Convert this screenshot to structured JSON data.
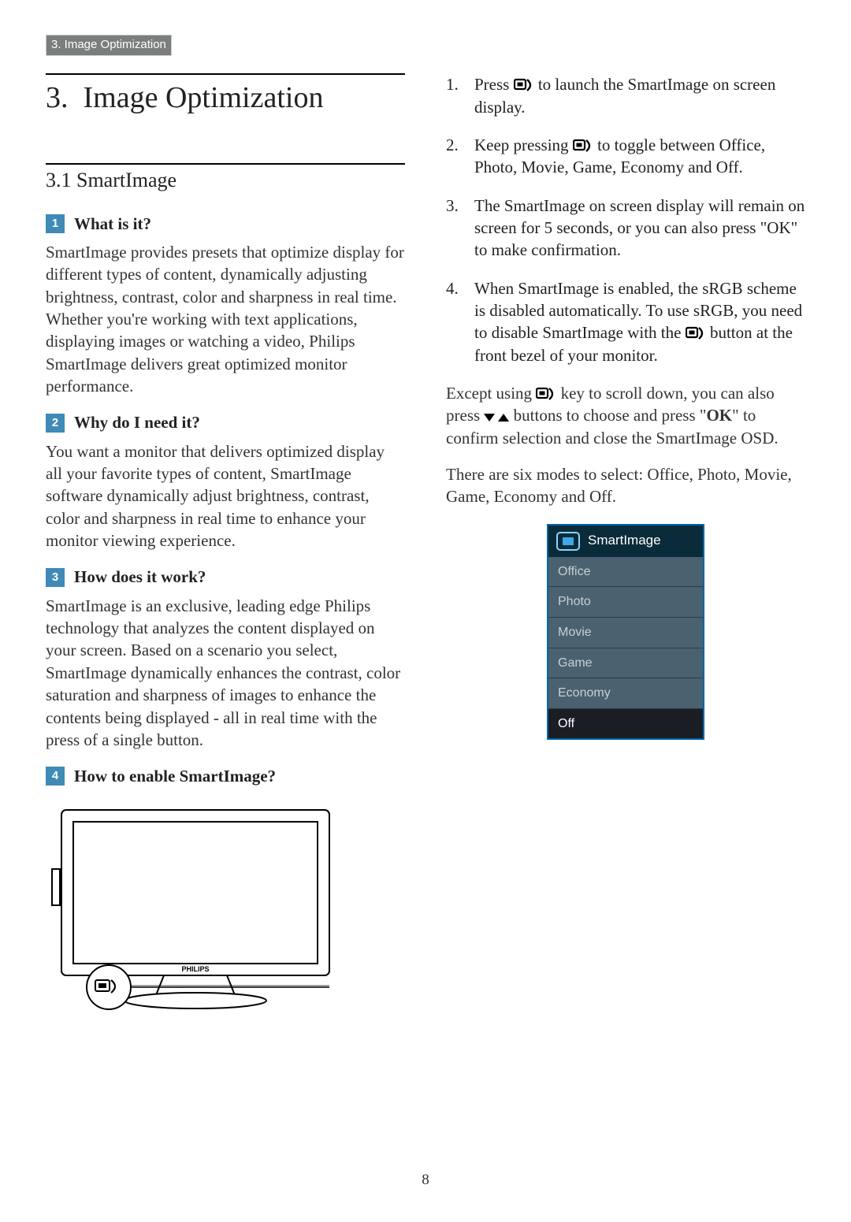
{
  "header_tab": "3. Image Optimization",
  "chapter": {
    "number": "3.",
    "title": "Image Optimization"
  },
  "section": {
    "number": "3.1",
    "title": "SmartImage"
  },
  "q1": {
    "num": "1",
    "heading": "What is it?",
    "body": "SmartImage provides presets that optimize display for different types of content, dynamically adjusting brightness, contrast, color and sharpness in real time. Whether you're working with text applications, displaying images or watching a video, Philips SmartImage delivers great optimized monitor performance."
  },
  "q2": {
    "num": "2",
    "heading": "Why do I need it?",
    "body": "You want a monitor that delivers optimized display all your favorite types of content, SmartImage software dynamically adjust brightness, contrast, color and sharpness in real time to enhance your monitor viewing experience."
  },
  "q3": {
    "num": "3",
    "heading": "How does it work?",
    "body": "SmartImage is an exclusive, leading edge Philips technology that analyzes the content displayed on your screen. Based on a scenario you select, SmartImage dynamically enhances the contrast, color saturation and sharpness of images to enhance the contents being displayed - all in real time with the press of a single button."
  },
  "q4": {
    "num": "4",
    "heading": "How to enable SmartImage?"
  },
  "steps": {
    "s1a": "Press ",
    "s1b": " to launch the SmartImage on screen display.",
    "s2a": "Keep pressing ",
    "s2b": " to toggle between Office, Photo, Movie, Game, Economy and Off.",
    "s3": "The SmartImage on screen display will remain on screen for 5 seconds, or you can also press \"OK\" to make confirmation.",
    "s4a": "When SmartImage is enabled, the sRGB scheme is disabled automatically. To use sRGB, you need to disable SmartImage with the ",
    "s4b": " button at the front bezel of your monitor."
  },
  "para_except_a": "Except using ",
  "para_except_b": " key to scroll down, you can also press ",
  "para_except_c": " buttons to choose and press \"",
  "para_except_ok": "OK",
  "para_except_d": "\" to confirm selection and close the SmartImage OSD.",
  "para_modes": "There are six modes to select: Office, Photo, Movie, Game, Economy and Off.",
  "osd": {
    "title": "SmartImage",
    "items": [
      "Office",
      "Photo",
      "Movie",
      "Game",
      "Economy",
      "Off"
    ],
    "selected_index": 5
  },
  "page_number": "8",
  "monitor_brand": "PHILIPS"
}
